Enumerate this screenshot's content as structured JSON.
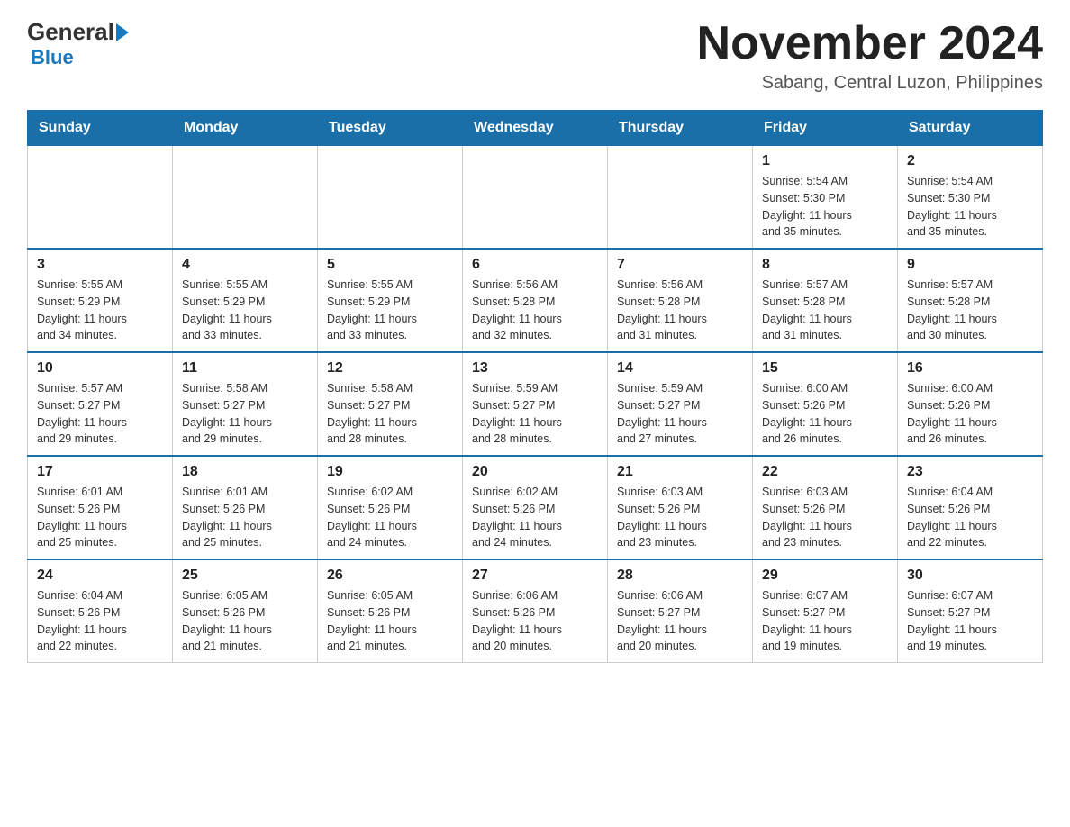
{
  "logo": {
    "general": "General",
    "blue": "Blue"
  },
  "header": {
    "month_year": "November 2024",
    "location": "Sabang, Central Luzon, Philippines"
  },
  "days_of_week": [
    "Sunday",
    "Monday",
    "Tuesday",
    "Wednesday",
    "Thursday",
    "Friday",
    "Saturday"
  ],
  "weeks": [
    {
      "cells": [
        {
          "day": "",
          "info": ""
        },
        {
          "day": "",
          "info": ""
        },
        {
          "day": "",
          "info": ""
        },
        {
          "day": "",
          "info": ""
        },
        {
          "day": "",
          "info": ""
        },
        {
          "day": "1",
          "info": "Sunrise: 5:54 AM\nSunset: 5:30 PM\nDaylight: 11 hours\nand 35 minutes."
        },
        {
          "day": "2",
          "info": "Sunrise: 5:54 AM\nSunset: 5:30 PM\nDaylight: 11 hours\nand 35 minutes."
        }
      ]
    },
    {
      "cells": [
        {
          "day": "3",
          "info": "Sunrise: 5:55 AM\nSunset: 5:29 PM\nDaylight: 11 hours\nand 34 minutes."
        },
        {
          "day": "4",
          "info": "Sunrise: 5:55 AM\nSunset: 5:29 PM\nDaylight: 11 hours\nand 33 minutes."
        },
        {
          "day": "5",
          "info": "Sunrise: 5:55 AM\nSunset: 5:29 PM\nDaylight: 11 hours\nand 33 minutes."
        },
        {
          "day": "6",
          "info": "Sunrise: 5:56 AM\nSunset: 5:28 PM\nDaylight: 11 hours\nand 32 minutes."
        },
        {
          "day": "7",
          "info": "Sunrise: 5:56 AM\nSunset: 5:28 PM\nDaylight: 11 hours\nand 31 minutes."
        },
        {
          "day": "8",
          "info": "Sunrise: 5:57 AM\nSunset: 5:28 PM\nDaylight: 11 hours\nand 31 minutes."
        },
        {
          "day": "9",
          "info": "Sunrise: 5:57 AM\nSunset: 5:28 PM\nDaylight: 11 hours\nand 30 minutes."
        }
      ]
    },
    {
      "cells": [
        {
          "day": "10",
          "info": "Sunrise: 5:57 AM\nSunset: 5:27 PM\nDaylight: 11 hours\nand 29 minutes."
        },
        {
          "day": "11",
          "info": "Sunrise: 5:58 AM\nSunset: 5:27 PM\nDaylight: 11 hours\nand 29 minutes."
        },
        {
          "day": "12",
          "info": "Sunrise: 5:58 AM\nSunset: 5:27 PM\nDaylight: 11 hours\nand 28 minutes."
        },
        {
          "day": "13",
          "info": "Sunrise: 5:59 AM\nSunset: 5:27 PM\nDaylight: 11 hours\nand 28 minutes."
        },
        {
          "day": "14",
          "info": "Sunrise: 5:59 AM\nSunset: 5:27 PM\nDaylight: 11 hours\nand 27 minutes."
        },
        {
          "day": "15",
          "info": "Sunrise: 6:00 AM\nSunset: 5:26 PM\nDaylight: 11 hours\nand 26 minutes."
        },
        {
          "day": "16",
          "info": "Sunrise: 6:00 AM\nSunset: 5:26 PM\nDaylight: 11 hours\nand 26 minutes."
        }
      ]
    },
    {
      "cells": [
        {
          "day": "17",
          "info": "Sunrise: 6:01 AM\nSunset: 5:26 PM\nDaylight: 11 hours\nand 25 minutes."
        },
        {
          "day": "18",
          "info": "Sunrise: 6:01 AM\nSunset: 5:26 PM\nDaylight: 11 hours\nand 25 minutes."
        },
        {
          "day": "19",
          "info": "Sunrise: 6:02 AM\nSunset: 5:26 PM\nDaylight: 11 hours\nand 24 minutes."
        },
        {
          "day": "20",
          "info": "Sunrise: 6:02 AM\nSunset: 5:26 PM\nDaylight: 11 hours\nand 24 minutes."
        },
        {
          "day": "21",
          "info": "Sunrise: 6:03 AM\nSunset: 5:26 PM\nDaylight: 11 hours\nand 23 minutes."
        },
        {
          "day": "22",
          "info": "Sunrise: 6:03 AM\nSunset: 5:26 PM\nDaylight: 11 hours\nand 23 minutes."
        },
        {
          "day": "23",
          "info": "Sunrise: 6:04 AM\nSunset: 5:26 PM\nDaylight: 11 hours\nand 22 minutes."
        }
      ]
    },
    {
      "cells": [
        {
          "day": "24",
          "info": "Sunrise: 6:04 AM\nSunset: 5:26 PM\nDaylight: 11 hours\nand 22 minutes."
        },
        {
          "day": "25",
          "info": "Sunrise: 6:05 AM\nSunset: 5:26 PM\nDaylight: 11 hours\nand 21 minutes."
        },
        {
          "day": "26",
          "info": "Sunrise: 6:05 AM\nSunset: 5:26 PM\nDaylight: 11 hours\nand 21 minutes."
        },
        {
          "day": "27",
          "info": "Sunrise: 6:06 AM\nSunset: 5:26 PM\nDaylight: 11 hours\nand 20 minutes."
        },
        {
          "day": "28",
          "info": "Sunrise: 6:06 AM\nSunset: 5:27 PM\nDaylight: 11 hours\nand 20 minutes."
        },
        {
          "day": "29",
          "info": "Sunrise: 6:07 AM\nSunset: 5:27 PM\nDaylight: 11 hours\nand 19 minutes."
        },
        {
          "day": "30",
          "info": "Sunrise: 6:07 AM\nSunset: 5:27 PM\nDaylight: 11 hours\nand 19 minutes."
        }
      ]
    }
  ]
}
